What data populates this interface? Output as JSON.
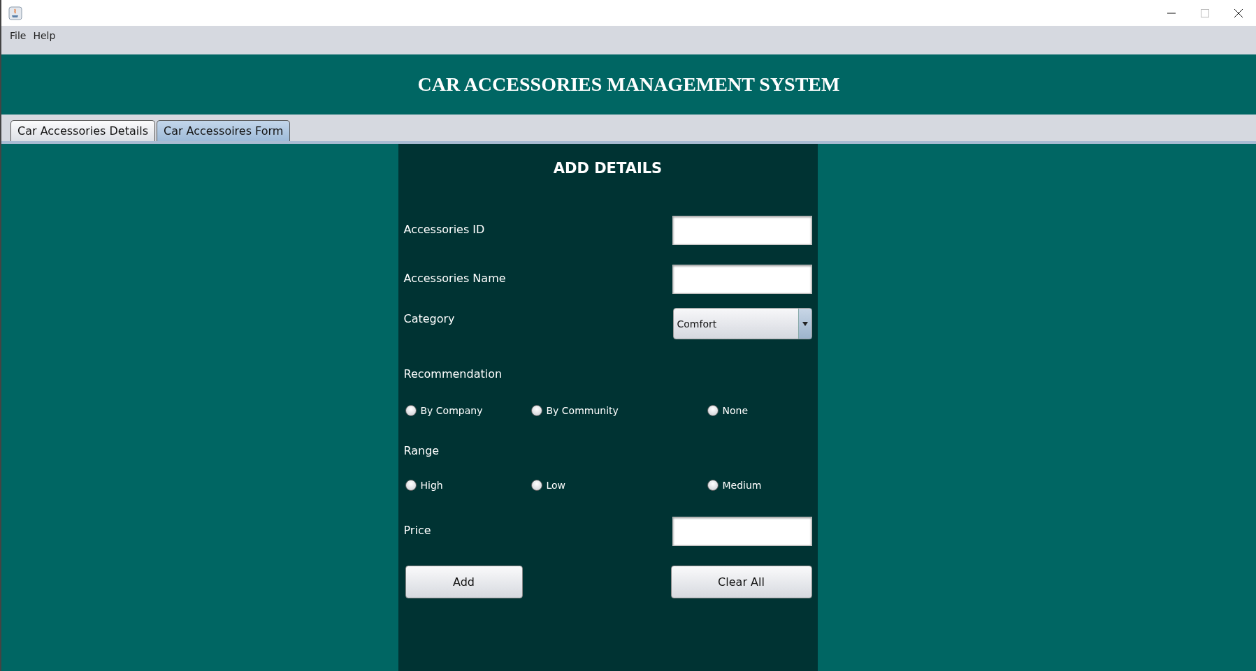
{
  "menu": [
    "File",
    "Help"
  ],
  "header": {
    "title": "CAR ACCESSORIES MANAGEMENT SYSTEM"
  },
  "tabs": [
    {
      "label": "Car Accessories Details",
      "selected": false
    },
    {
      "label": "Car Accessoires Form",
      "selected": true
    }
  ],
  "form": {
    "title": "ADD DETAILS",
    "fields": [
      {
        "kind": "text",
        "label": "Accessories ID"
      },
      {
        "kind": "text",
        "label": "Accessories Name"
      },
      {
        "kind": "select",
        "label": "Category",
        "value": "Comfort"
      },
      {
        "kind": "radio",
        "label": "Recommendation",
        "options": [
          {
            "label": "By Company",
            "selected": false
          },
          {
            "label": "By Community",
            "selected": false
          },
          {
            "label": "None",
            "selected": false
          }
        ]
      },
      {
        "kind": "radio",
        "label": "Range",
        "options": [
          {
            "label": "High",
            "selected": false
          },
          {
            "label": "Low",
            "selected": false
          },
          {
            "label": "Medium",
            "selected": false
          }
        ]
      },
      {
        "kind": "text",
        "label": "Price"
      }
    ],
    "buttons": [
      "Add",
      "Clear All"
    ]
  }
}
